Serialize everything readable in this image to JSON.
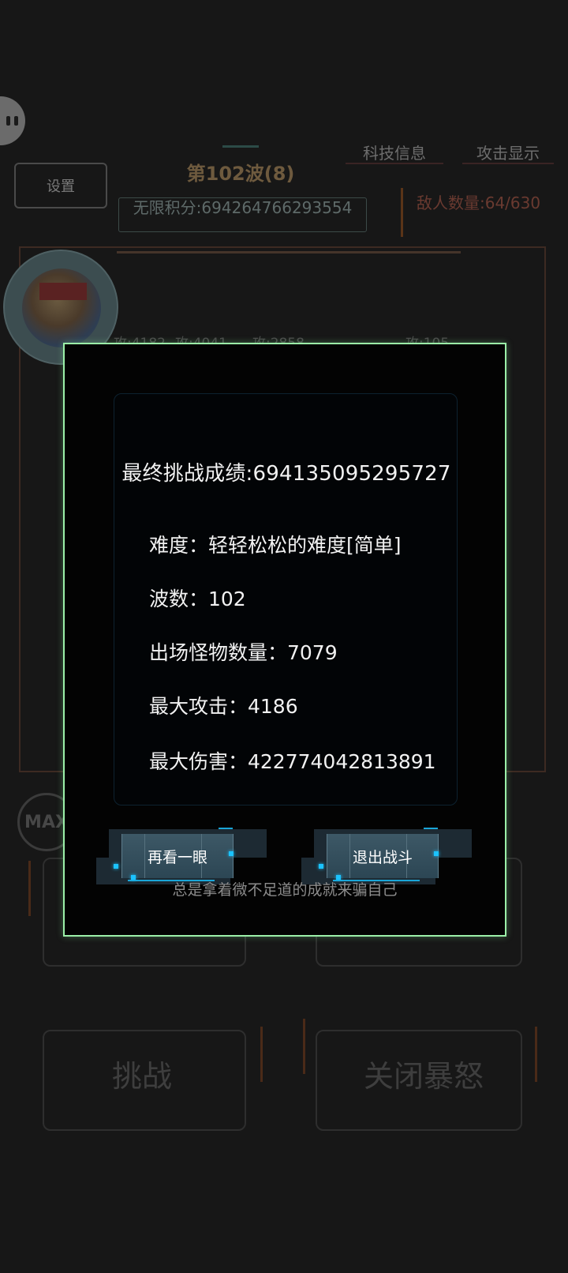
{
  "hud": {
    "settings_label": "设置",
    "wave_title": "第102波(8)",
    "score_text": "无限积分:694264766293554",
    "tech_info_label": "科技信息",
    "attack_display_label": "攻击显示",
    "enemy_count_text": "敌人数量:64/630",
    "attack_labels": [
      "攻:4182",
      "攻:4041",
      "攻:2858",
      "攻:105"
    ],
    "max_label": "MAX",
    "challenge_label": "挑战",
    "close_rage_label": "关闭暴怒"
  },
  "dialog": {
    "final_score": "最终挑战成绩:694135095295727",
    "difficulty": "难度：轻轻松松的难度[简单]",
    "waves": "波数：102",
    "monsters": "出场怪物数量：7079",
    "max_attack": "最大攻击：4186",
    "max_damage": "最大伤害：422774042813891",
    "review_button": "再看一眼",
    "exit_button": "退出战斗",
    "taunt": "总是拿着微不足道的成就来骗自己"
  },
  "colors": {
    "dialog_border": "#9bf0a8",
    "button_accent": "#1bc3ff",
    "background": "#171717"
  }
}
